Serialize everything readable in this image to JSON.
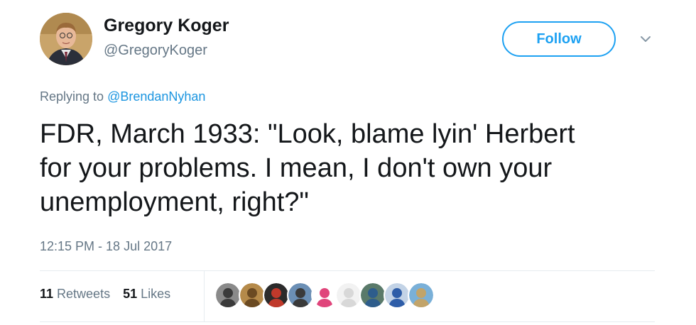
{
  "author": {
    "name": "Gregory Koger",
    "handle": "@GregoryKoger"
  },
  "follow_label": "Follow",
  "reply": {
    "prefix": "Replying to ",
    "mention": "@BrendanNyhan"
  },
  "tweet": {
    "lines": [
      "FDR, March 1933: \"Look, blame lyin' Herbert",
      "for your problems. I mean, I don't own your",
      "unemployment, right?\""
    ]
  },
  "timestamp": "12:15 PM - 18 Jul 2017",
  "stats": {
    "retweets_count": "11",
    "retweets_label": "Retweets",
    "likes_count": "51",
    "likes_label": "Likes"
  },
  "colors": {
    "accent": "#1da1f2",
    "mention": "#1b95e0",
    "muted": "#657786"
  },
  "icons": {
    "caret": "chevron-down-icon"
  },
  "liker_avatars": [
    {
      "bg": "#8a8a8a",
      "fg": "#3a3a3a"
    },
    {
      "bg": "#b58a4a",
      "fg": "#6b4a22"
    },
    {
      "bg": "#2b2b2b",
      "fg": "#c0392b"
    },
    {
      "bg": "#6b8fb5",
      "fg": "#3a3a3a"
    },
    {
      "bg": "#ffffff",
      "fg": "#e0457b"
    },
    {
      "bg": "#f2f2f2",
      "fg": "#d8d8d8"
    },
    {
      "bg": "#5a7a6a",
      "fg": "#2e5d8c"
    },
    {
      "bg": "#c3d3e6",
      "fg": "#2e5da8"
    },
    {
      "bg": "#7ab0d8",
      "fg": "#c2a46a"
    }
  ]
}
